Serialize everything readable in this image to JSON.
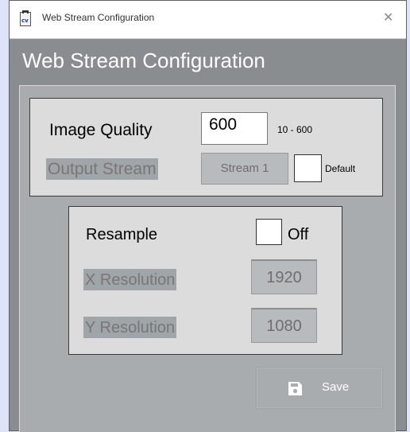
{
  "window": {
    "title": "Web Stream Configuration",
    "app_icon_text": "cv",
    "close_glyph": "✕"
  },
  "page": {
    "heading": "Web Stream Configuration"
  },
  "image_quality": {
    "label": "Image Quality",
    "value": "600",
    "range": "10 - 600"
  },
  "output_stream": {
    "label": "Output Stream",
    "value": "Stream 1",
    "default_label": "Default",
    "default_checked": false
  },
  "resample": {
    "label": "Resample",
    "state_label": "Off",
    "checked": false
  },
  "x_resolution": {
    "label": "X Resolution",
    "value": "1920"
  },
  "y_resolution": {
    "label": "Y Resolution",
    "value": "1080"
  },
  "save": {
    "label": "Save",
    "icon": "save-icon"
  }
}
